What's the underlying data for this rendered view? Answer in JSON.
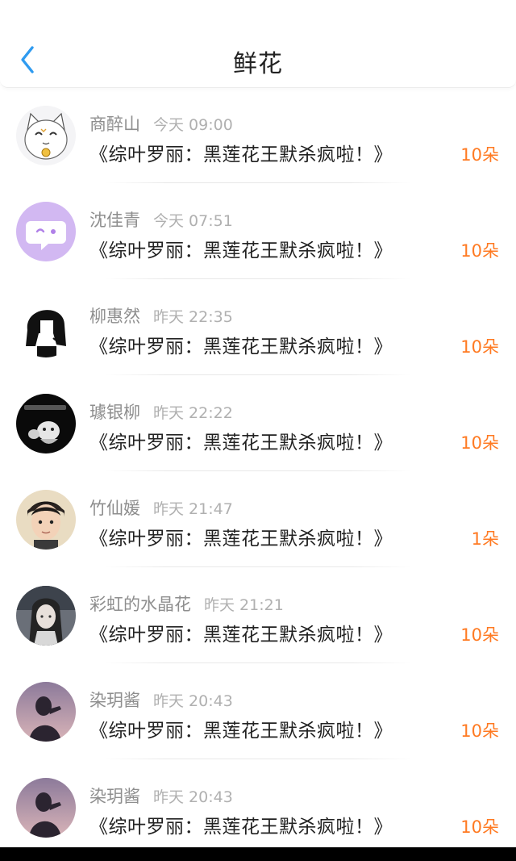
{
  "header": {
    "title": "鲜花",
    "back_icon": "chevron-left-icon",
    "accent_color": "#2f9bf0"
  },
  "list": {
    "items": [
      {
        "name": "商醉山",
        "time": "今天 09:00",
        "book": "《综叶罗丽：黑莲花王默杀疯啦！》",
        "count": "10朵",
        "avatar": "cat-avatar"
      },
      {
        "name": "沈佳青",
        "time": "今天 07:51",
        "book": "《综叶罗丽：黑莲花王默杀疯啦！》",
        "count": "10朵",
        "avatar": "chat-bubble-avatar"
      },
      {
        "name": "柳惠然",
        "time": "昨天 22:35",
        "book": "《综叶罗丽：黑莲花王默杀疯啦！》",
        "count": "10朵",
        "avatar": "girl-sketch-avatar"
      },
      {
        "name": "璩银柳",
        "time": "昨天 22:22",
        "book": "《综叶罗丽：黑莲花王默杀疯啦！》",
        "count": "10朵",
        "avatar": "dark-cartoon-avatar"
      },
      {
        "name": "竹仙媛",
        "time": "昨天 21:47",
        "book": "《综叶罗丽：黑莲花王默杀疯啦！》",
        "count": "1朵",
        "avatar": "boy-photo-avatar"
      },
      {
        "name": "彩虹的水晶花",
        "time": "昨天 21:21",
        "book": "《综叶罗丽：黑莲花王默杀疯啦！》",
        "count": "10朵",
        "avatar": "anime-girl-avatar"
      },
      {
        "name": "染玥酱",
        "time": "昨天 20:43",
        "book": "《综叶罗丽：黑莲花王默杀疯啦！》",
        "count": "10朵",
        "avatar": "silhouette-avatar"
      },
      {
        "name": "染玥酱",
        "time": "昨天 20:43",
        "book": "《综叶罗丽：黑莲花王默杀疯啦！》",
        "count": "10朵",
        "avatar": "silhouette-avatar"
      }
    ]
  },
  "colors": {
    "count": "#ff7a22",
    "name": "#8e8e8e",
    "time": "#b0b0b0",
    "book": "#222222"
  }
}
